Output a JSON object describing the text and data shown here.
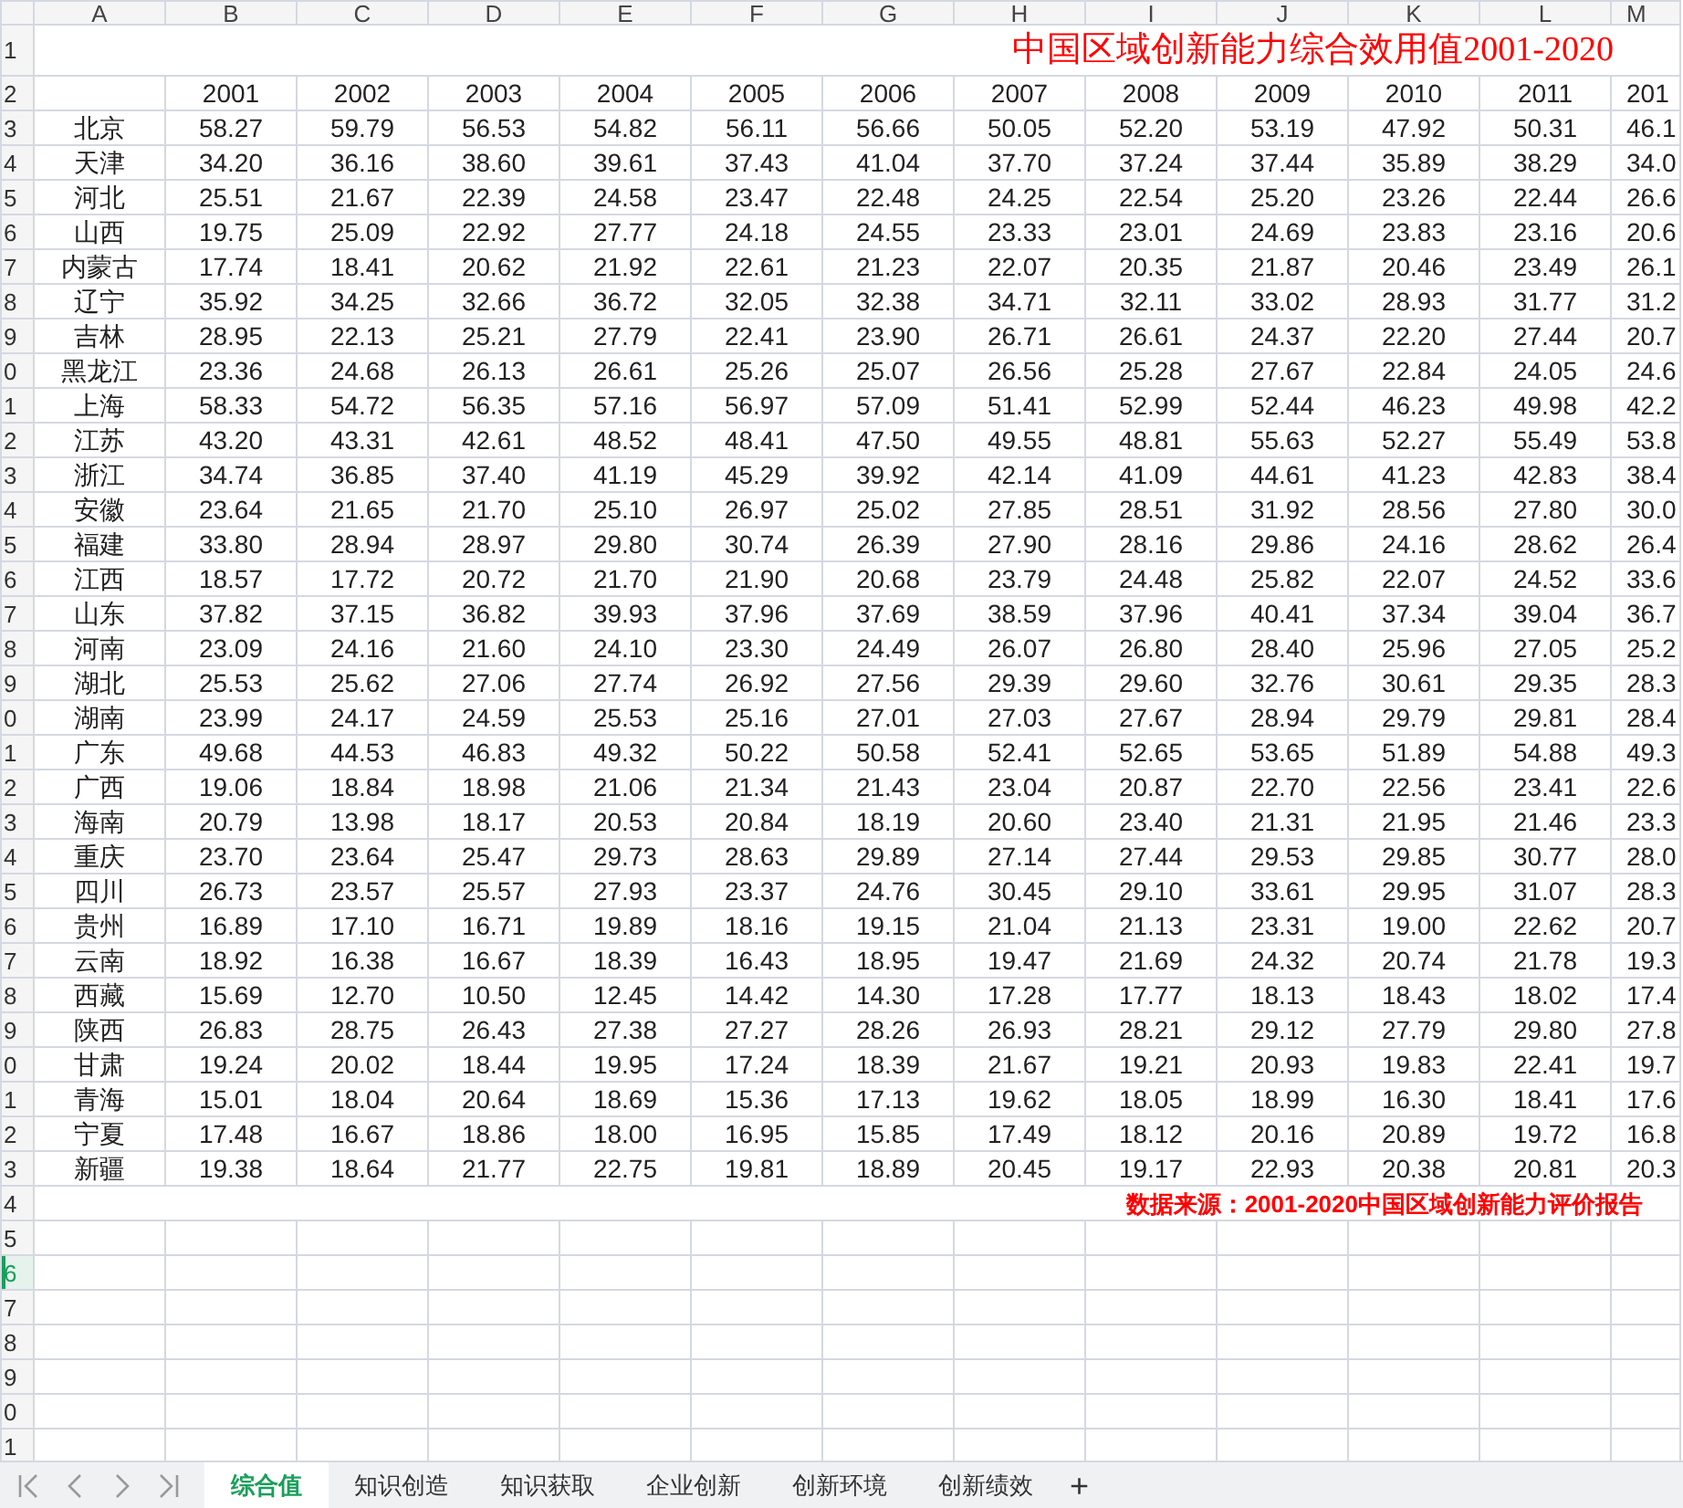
{
  "sheet": {
    "column_headers": [
      "A",
      "B",
      "C",
      "D",
      "E",
      "F",
      "G",
      "H",
      "I",
      "J",
      "K",
      "L",
      "M"
    ],
    "row_headers": [
      {
        "label": "1",
        "selected": false
      },
      {
        "label": "2",
        "selected": false
      },
      {
        "label": "3",
        "selected": false
      },
      {
        "label": "4",
        "selected": false
      },
      {
        "label": "5",
        "selected": false
      },
      {
        "label": "6",
        "selected": false
      },
      {
        "label": "7",
        "selected": false
      },
      {
        "label": "8",
        "selected": false
      },
      {
        "label": "9",
        "selected": false
      },
      {
        "label": "0",
        "selected": false
      },
      {
        "label": "1",
        "selected": false
      },
      {
        "label": "2",
        "selected": false
      },
      {
        "label": "3",
        "selected": false
      },
      {
        "label": "4",
        "selected": false
      },
      {
        "label": "5",
        "selected": false
      },
      {
        "label": "6",
        "selected": false
      },
      {
        "label": "7",
        "selected": false
      },
      {
        "label": "8",
        "selected": false
      },
      {
        "label": "9",
        "selected": false
      },
      {
        "label": "0",
        "selected": false
      },
      {
        "label": "1",
        "selected": false
      },
      {
        "label": "2",
        "selected": false
      },
      {
        "label": "3",
        "selected": false
      },
      {
        "label": "4",
        "selected": false
      },
      {
        "label": "5",
        "selected": false
      },
      {
        "label": "6",
        "selected": false
      },
      {
        "label": "7",
        "selected": false
      },
      {
        "label": "8",
        "selected": false
      },
      {
        "label": "9",
        "selected": false
      },
      {
        "label": "0",
        "selected": false
      },
      {
        "label": "1",
        "selected": false
      },
      {
        "label": "2",
        "selected": false
      },
      {
        "label": "3",
        "selected": false
      },
      {
        "label": "4",
        "selected": false
      },
      {
        "label": "5",
        "selected": false
      },
      {
        "label": "6",
        "selected": true
      },
      {
        "label": "7",
        "selected": false
      },
      {
        "label": "8",
        "selected": false
      },
      {
        "label": "9",
        "selected": false
      },
      {
        "label": "0",
        "selected": false
      },
      {
        "label": "1",
        "selected": false
      }
    ],
    "title": "中国区域创新能力综合效用值2001-2020",
    "year_header": [
      "2001",
      "2002",
      "2003",
      "2004",
      "2005",
      "2006",
      "2007",
      "2008",
      "2009",
      "2010",
      "2011",
      "201"
    ],
    "rows": [
      {
        "region": "北京",
        "values": [
          "58.27",
          "59.79",
          "56.53",
          "54.82",
          "56.11",
          "56.66",
          "50.05",
          "52.20",
          "53.19",
          "47.92",
          "50.31",
          "46.1"
        ]
      },
      {
        "region": "天津",
        "values": [
          "34.20",
          "36.16",
          "38.60",
          "39.61",
          "37.43",
          "41.04",
          "37.70",
          "37.24",
          "37.44",
          "35.89",
          "38.29",
          "34.0"
        ]
      },
      {
        "region": "河北",
        "values": [
          "25.51",
          "21.67",
          "22.39",
          "24.58",
          "23.47",
          "22.48",
          "24.25",
          "22.54",
          "25.20",
          "23.26",
          "22.44",
          "26.6"
        ]
      },
      {
        "region": "山西",
        "values": [
          "19.75",
          "25.09",
          "22.92",
          "27.77",
          "24.18",
          "24.55",
          "23.33",
          "23.01",
          "24.69",
          "23.83",
          "23.16",
          "20.6"
        ]
      },
      {
        "region": "内蒙古",
        "values": [
          "17.74",
          "18.41",
          "20.62",
          "21.92",
          "22.61",
          "21.23",
          "22.07",
          "20.35",
          "21.87",
          "20.46",
          "23.49",
          "26.1"
        ]
      },
      {
        "region": "辽宁",
        "values": [
          "35.92",
          "34.25",
          "32.66",
          "36.72",
          "32.05",
          "32.38",
          "34.71",
          "32.11",
          "33.02",
          "28.93",
          "31.77",
          "31.2"
        ]
      },
      {
        "region": "吉林",
        "values": [
          "28.95",
          "22.13",
          "25.21",
          "27.79",
          "22.41",
          "23.90",
          "26.71",
          "26.61",
          "24.37",
          "22.20",
          "27.44",
          "20.7"
        ]
      },
      {
        "region": "黑龙江",
        "values": [
          "23.36",
          "24.68",
          "26.13",
          "26.61",
          "25.26",
          "25.07",
          "26.56",
          "25.28",
          "27.67",
          "22.84",
          "24.05",
          "24.6"
        ]
      },
      {
        "region": "上海",
        "values": [
          "58.33",
          "54.72",
          "56.35",
          "57.16",
          "56.97",
          "57.09",
          "51.41",
          "52.99",
          "52.44",
          "46.23",
          "49.98",
          "42.2"
        ]
      },
      {
        "region": "江苏",
        "values": [
          "43.20",
          "43.31",
          "42.61",
          "48.52",
          "48.41",
          "47.50",
          "49.55",
          "48.81",
          "55.63",
          "52.27",
          "55.49",
          "53.8"
        ]
      },
      {
        "region": "浙江",
        "values": [
          "34.74",
          "36.85",
          "37.40",
          "41.19",
          "45.29",
          "39.92",
          "42.14",
          "41.09",
          "44.61",
          "41.23",
          "42.83",
          "38.4"
        ]
      },
      {
        "region": "安徽",
        "values": [
          "23.64",
          "21.65",
          "21.70",
          "25.10",
          "26.97",
          "25.02",
          "27.85",
          "28.51",
          "31.92",
          "28.56",
          "27.80",
          "30.0"
        ]
      },
      {
        "region": "福建",
        "values": [
          "33.80",
          "28.94",
          "28.97",
          "29.80",
          "30.74",
          "26.39",
          "27.90",
          "28.16",
          "29.86",
          "24.16",
          "28.62",
          "26.4"
        ]
      },
      {
        "region": "江西",
        "values": [
          "18.57",
          "17.72",
          "20.72",
          "21.70",
          "21.90",
          "20.68",
          "23.79",
          "24.48",
          "25.82",
          "22.07",
          "24.52",
          "33.6"
        ]
      },
      {
        "region": "山东",
        "values": [
          "37.82",
          "37.15",
          "36.82",
          "39.93",
          "37.96",
          "37.69",
          "38.59",
          "37.96",
          "40.41",
          "37.34",
          "39.04",
          "36.7"
        ]
      },
      {
        "region": "河南",
        "values": [
          "23.09",
          "24.16",
          "21.60",
          "24.10",
          "23.30",
          "24.49",
          "26.07",
          "26.80",
          "28.40",
          "25.96",
          "27.05",
          "25.2"
        ]
      },
      {
        "region": "湖北",
        "values": [
          "25.53",
          "25.62",
          "27.06",
          "27.74",
          "26.92",
          "27.56",
          "29.39",
          "29.60",
          "32.76",
          "30.61",
          "29.35",
          "28.3"
        ]
      },
      {
        "region": "湖南",
        "values": [
          "23.99",
          "24.17",
          "24.59",
          "25.53",
          "25.16",
          "27.01",
          "27.03",
          "27.67",
          "28.94",
          "29.79",
          "29.81",
          "28.4"
        ]
      },
      {
        "region": "广东",
        "values": [
          "49.68",
          "44.53",
          "46.83",
          "49.32",
          "50.22",
          "50.58",
          "52.41",
          "52.65",
          "53.65",
          "51.89",
          "54.88",
          "49.3"
        ]
      },
      {
        "region": "广西",
        "values": [
          "19.06",
          "18.84",
          "18.98",
          "21.06",
          "21.34",
          "21.43",
          "23.04",
          "20.87",
          "22.70",
          "22.56",
          "23.41",
          "22.6"
        ]
      },
      {
        "region": "海南",
        "values": [
          "20.79",
          "13.98",
          "18.17",
          "20.53",
          "20.84",
          "18.19",
          "20.60",
          "23.40",
          "21.31",
          "21.95",
          "21.46",
          "23.3"
        ]
      },
      {
        "region": "重庆",
        "values": [
          "23.70",
          "23.64",
          "25.47",
          "29.73",
          "28.63",
          "29.89",
          "27.14",
          "27.44",
          "29.53",
          "29.85",
          "30.77",
          "28.0"
        ]
      },
      {
        "region": "四川",
        "values": [
          "26.73",
          "23.57",
          "25.57",
          "27.93",
          "23.37",
          "24.76",
          "30.45",
          "29.10",
          "33.61",
          "29.95",
          "31.07",
          "28.3"
        ]
      },
      {
        "region": "贵州",
        "values": [
          "16.89",
          "17.10",
          "16.71",
          "19.89",
          "18.16",
          "19.15",
          "21.04",
          "21.13",
          "23.31",
          "19.00",
          "22.62",
          "20.7"
        ]
      },
      {
        "region": "云南",
        "values": [
          "18.92",
          "16.38",
          "16.67",
          "18.39",
          "16.43",
          "18.95",
          "19.47",
          "21.69",
          "24.32",
          "20.74",
          "21.78",
          "19.3"
        ]
      },
      {
        "region": "西藏",
        "values": [
          "15.69",
          "12.70",
          "10.50",
          "12.45",
          "14.42",
          "14.30",
          "17.28",
          "17.77",
          "18.13",
          "18.43",
          "18.02",
          "17.4"
        ]
      },
      {
        "region": "陕西",
        "values": [
          "26.83",
          "28.75",
          "26.43",
          "27.38",
          "27.27",
          "28.26",
          "26.93",
          "28.21",
          "29.12",
          "27.79",
          "29.80",
          "27.8"
        ]
      },
      {
        "region": "甘肃",
        "values": [
          "19.24",
          "20.02",
          "18.44",
          "19.95",
          "17.24",
          "18.39",
          "21.67",
          "19.21",
          "20.93",
          "19.83",
          "22.41",
          "19.7"
        ]
      },
      {
        "region": "青海",
        "values": [
          "15.01",
          "18.04",
          "20.64",
          "18.69",
          "15.36",
          "17.13",
          "19.62",
          "18.05",
          "18.99",
          "16.30",
          "18.41",
          "17.6"
        ]
      },
      {
        "region": "宁夏",
        "values": [
          "17.48",
          "16.67",
          "18.86",
          "18.00",
          "16.95",
          "15.85",
          "17.49",
          "18.12",
          "20.16",
          "20.89",
          "19.72",
          "16.8"
        ]
      },
      {
        "region": "新疆",
        "values": [
          "19.38",
          "18.64",
          "21.77",
          "22.75",
          "19.81",
          "18.89",
          "20.45",
          "19.17",
          "22.93",
          "20.38",
          "20.81",
          "20.3"
        ]
      }
    ],
    "source_note": "数据来源：2001-2020中国区域创新能力评价报告"
  },
  "sheet_tabs": [
    {
      "label": "综合值",
      "selected": true
    },
    {
      "label": "知识创造",
      "selected": false
    },
    {
      "label": "知识获取",
      "selected": false
    },
    {
      "label": "企业创新",
      "selected": false
    },
    {
      "label": "创新环境",
      "selected": false
    },
    {
      "label": "创新绩效",
      "selected": false
    }
  ],
  "add_tab": "+"
}
